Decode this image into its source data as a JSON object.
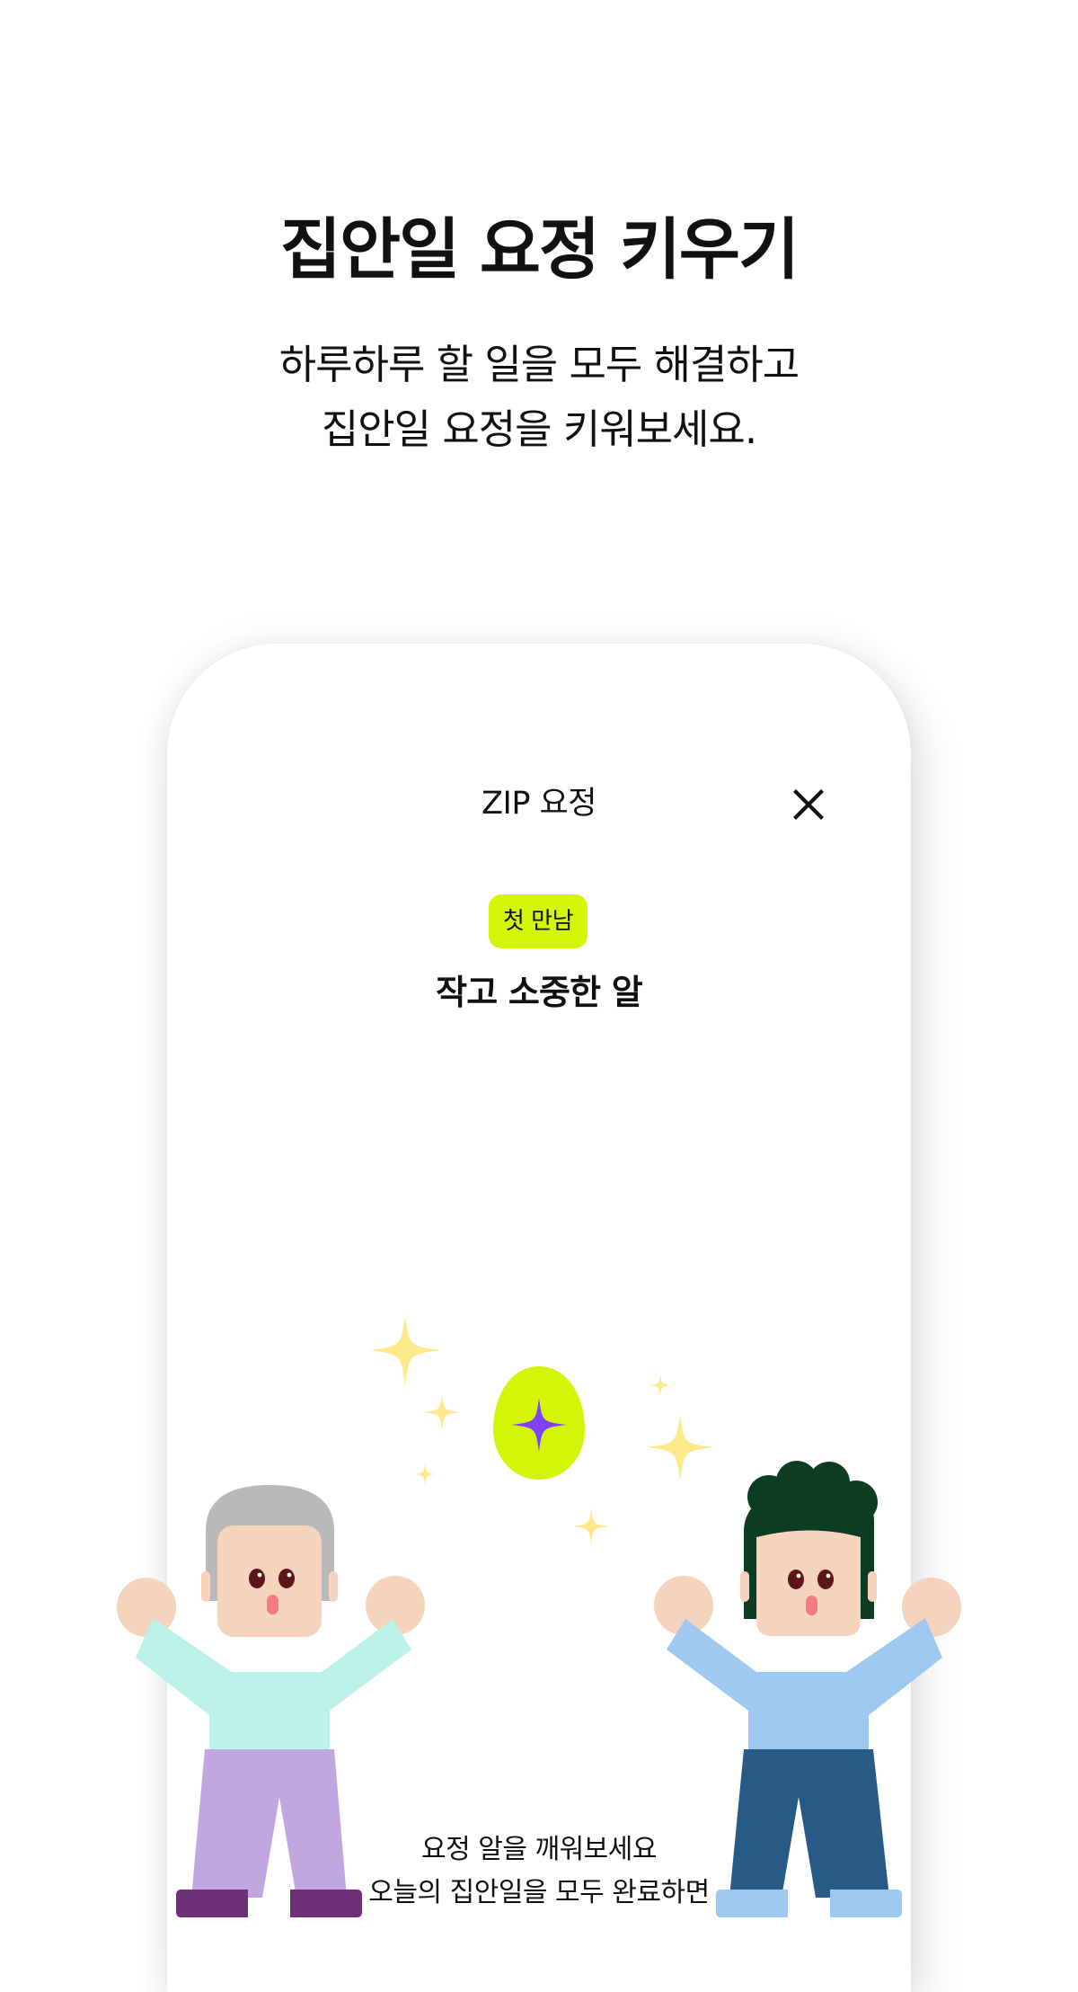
{
  "hero": {
    "title": "집안일 요정 키우기",
    "subtitle_lines": [
      "하루하루 할 일을 모두 해결하고",
      "집안일 요정을 키워보세요."
    ]
  },
  "modal": {
    "title": "ZIP 요정",
    "close_icon": "close-icon",
    "badge": "첫 만남",
    "fairy_name": "작고 소중한 알",
    "bottom_lines": [
      "요정 알을 깨워보세요",
      "오늘의 집안일을 모두 완료하면"
    ]
  },
  "illustration": {
    "egg_icon": "egg-icon",
    "sparkle_icon": "sparkle-icon",
    "left_character_icon": "elder-character-icon",
    "right_character_icon": "young-character-icon"
  },
  "colors": {
    "accent_lime": "#d4f505",
    "egg_purple": "#7e42ff",
    "sparkle_yellow": "#ffe98a",
    "skin": "#f5d3bd",
    "left_shirt": "#bdf2e8",
    "left_pants": "#c2a6df",
    "left_shoes": "#6f2e78",
    "left_hair": "#b8b9b8",
    "right_shirt": "#9ec8ef",
    "right_pants": "#285a86",
    "right_shoes": "#9ec8ef",
    "right_hair": "#0c3d22"
  }
}
